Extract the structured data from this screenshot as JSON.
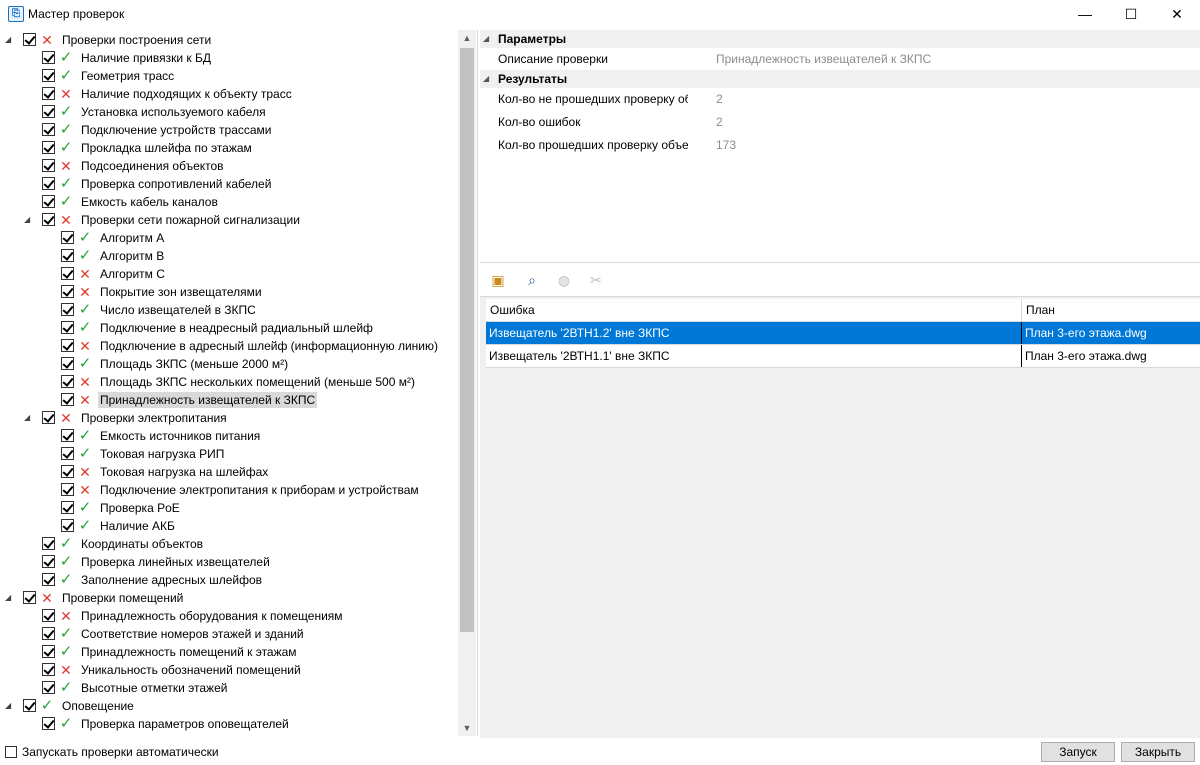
{
  "window": {
    "title": "Мастер проверок",
    "min_glyph": "—",
    "max_glyph": "☐",
    "close_glyph": "✕"
  },
  "tree": [
    {
      "label": "Проверки построения сети",
      "level": 0,
      "status": "err",
      "expanded": true
    },
    {
      "label": "Наличие привязки к БД",
      "level": 1,
      "status": "ok"
    },
    {
      "label": "Геометрия трасс",
      "level": 1,
      "status": "ok"
    },
    {
      "label": "Наличие подходящих к объекту трасс",
      "level": 1,
      "status": "err"
    },
    {
      "label": "Установка используемого кабеля",
      "level": 1,
      "status": "ok"
    },
    {
      "label": "Подключение устройств трассами",
      "level": 1,
      "status": "ok"
    },
    {
      "label": "Прокладка шлейфа по этажам",
      "level": 1,
      "status": "ok"
    },
    {
      "label": "Подсоединения объектов",
      "level": 1,
      "status": "err"
    },
    {
      "label": "Проверка сопротивлений кабелей",
      "level": 1,
      "status": "ok"
    },
    {
      "label": "Емкость кабель каналов",
      "level": 1,
      "status": "ok"
    },
    {
      "label": "Проверки сети пожарной сигнализации",
      "level": 1,
      "status": "err",
      "expanded": true
    },
    {
      "label": "Алгоритм А",
      "level": 2,
      "status": "ok"
    },
    {
      "label": "Алгоритм В",
      "level": 2,
      "status": "ok"
    },
    {
      "label": "Алгоритм С",
      "level": 2,
      "status": "err"
    },
    {
      "label": "Покрытие зон извещателями",
      "level": 2,
      "status": "err"
    },
    {
      "label": "Число извещателей в ЗКПС",
      "level": 2,
      "status": "ok"
    },
    {
      "label": "Подключение в неадресный радиальный шлейф",
      "level": 2,
      "status": "ok"
    },
    {
      "label": "Подключение в адресный шлейф (информационную линию)",
      "level": 2,
      "status": "err"
    },
    {
      "label": "Площадь ЗКПС (меньше 2000 м²)",
      "level": 2,
      "status": "ok"
    },
    {
      "label": "Площадь ЗКПС нескольких помещений (меньше 500 м²)",
      "level": 2,
      "status": "err"
    },
    {
      "label": "Принадлежность извещателей к ЗКПС",
      "level": 2,
      "status": "err",
      "selected": true
    },
    {
      "label": "Проверки электропитания",
      "level": 1,
      "status": "err",
      "expanded": true
    },
    {
      "label": "Емкость источников питания",
      "level": 2,
      "status": "ok"
    },
    {
      "label": "Токовая нагрузка РИП",
      "level": 2,
      "status": "ok"
    },
    {
      "label": "Токовая нагрузка на шлейфах",
      "level": 2,
      "status": "err"
    },
    {
      "label": "Подключение электропитания к приборам и устройствам",
      "level": 2,
      "status": "err"
    },
    {
      "label": "Проверка PoE",
      "level": 2,
      "status": "ok"
    },
    {
      "label": "Наличие АКБ",
      "level": 2,
      "status": "ok"
    },
    {
      "label": "Координаты объектов",
      "level": 1,
      "status": "ok"
    },
    {
      "label": "Проверка линейных извещателей",
      "level": 1,
      "status": "ok"
    },
    {
      "label": "Заполнение адресных шлейфов",
      "level": 1,
      "status": "ok"
    },
    {
      "label": "Проверки помещений",
      "level": 0,
      "status": "err",
      "expanded": true
    },
    {
      "label": "Принадлежность оборудования к помещениям",
      "level": 1,
      "status": "err"
    },
    {
      "label": "Соответствие номеров этажей и зданий",
      "level": 1,
      "status": "ok"
    },
    {
      "label": "Принадлежность помещений к этажам",
      "level": 1,
      "status": "ok"
    },
    {
      "label": "Уникальность обозначений помещений",
      "level": 1,
      "status": "err"
    },
    {
      "label": "Высотные отметки этажей",
      "level": 1,
      "status": "ok"
    },
    {
      "label": "Оповещение",
      "level": 0,
      "status": "ok",
      "expanded": true
    },
    {
      "label": "Проверка параметров оповещателей",
      "level": 1,
      "status": "ok"
    }
  ],
  "properties": {
    "params_title": "Параметры",
    "description_key": "Описание проверки",
    "description_value": "Принадлежность извещателей к ЗКПС",
    "results_title": "Результаты",
    "results": [
      {
        "key": "Кол-во не прошедших проверку об...",
        "value": "2"
      },
      {
        "key": "Кол-во ошибок",
        "value": "2"
      },
      {
        "key": "Кол-во прошедших проверку объек...",
        "value": "173"
      }
    ]
  },
  "errors_table": {
    "columns": [
      "Ошибка",
      "План"
    ],
    "rows": [
      {
        "error": "Извещатель '2ВТН1.2' вне ЗКПС",
        "plan": "План 3-его этажа.dwg",
        "selected": true
      },
      {
        "error": "Извещатель '2ВТН1.1' вне ЗКПС",
        "plan": "План 3-его этажа.dwg",
        "selected": false
      }
    ]
  },
  "footer": {
    "auto_run_label": "Запускать проверки автоматически",
    "run_button": "Запуск",
    "close_button": "Закрыть"
  },
  "glyphs": {
    "ok": "✓",
    "err": "✕",
    "expanded": "◢",
    "scroll_up": "▲",
    "scroll_down": "▼"
  }
}
